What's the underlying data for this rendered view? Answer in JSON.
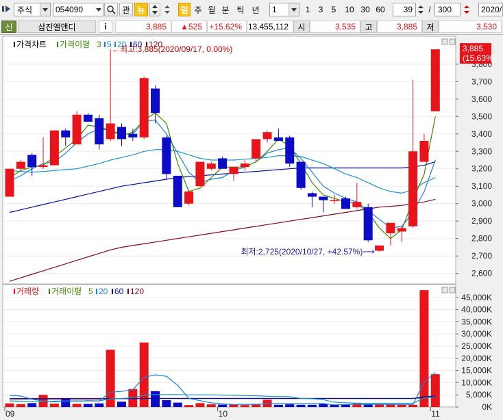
{
  "toolbar": {
    "market": "주식",
    "code": "054090",
    "fav_label": "관",
    "news_label": "뉴",
    "periods": [
      "일",
      "주",
      "월",
      "분",
      "틱",
      "년"
    ],
    "multiplier": "1",
    "quick_counts": [
      "1",
      "3",
      "5",
      "10",
      "30",
      "60"
    ],
    "bar_count": "39",
    "bar_total": "300",
    "date": "2020/"
  },
  "infobar": {
    "credit_label": "신",
    "name": "삼진엘앤디",
    "info_icon": "i",
    "price": "3,885",
    "change": "▲525",
    "change_pct": "+15.62%",
    "volume": "13,455,112",
    "open_label": "시",
    "open": "3,535",
    "high_label": "고",
    "high": "3,885",
    "low_label": "저",
    "low": "3,530"
  },
  "colors": {
    "up": "#e8141b",
    "down": "#0b0bc8",
    "ma3": "#3a8a00",
    "ma5": "#1e7fd6",
    "ma20": "#1c93c4",
    "ma60": "#000fa0",
    "ma120": "#7a0a22"
  },
  "chart_data": [
    {
      "type": "candlestick",
      "title": "가격차트",
      "legend": [
        "가격이평",
        "3",
        "5",
        "20",
        "60",
        "120"
      ],
      "ylim": [
        2540,
        3960
      ],
      "yticks": [
        2600,
        2700,
        2800,
        2900,
        3000,
        3100,
        3200,
        3300,
        3400,
        3500,
        3600,
        3700,
        3800,
        3885
      ],
      "ytick_labels": [
        "2,600",
        "2,700",
        "2,800",
        "2,900",
        "3,000",
        "3,100",
        "3,200",
        "3,300",
        "3,400",
        "3,500",
        "3,600",
        "3,700",
        "3,800",
        "3,885"
      ],
      "last_price_label": "3,885",
      "last_pct_label": "(15.63%)",
      "high_annotation": "←최고:3,885(2020/09/17, 0.00%)",
      "low_annotation": "최저:2,725(2020/10/27, +42.57%)⟶",
      "x_labels": [
        "09",
        "10",
        "11"
      ],
      "x_label_index": [
        0,
        19,
        38
      ],
      "candles": [
        {
          "o": 3040,
          "h": 3200,
          "l": 3040,
          "c": 3200
        },
        {
          "o": 3200,
          "h": 3250,
          "l": 3190,
          "c": 3240
        },
        {
          "o": 3280,
          "h": 3290,
          "l": 3160,
          "c": 3210
        },
        {
          "o": 3210,
          "h": 3380,
          "l": 3200,
          "c": 3220
        },
        {
          "o": 3220,
          "h": 3420,
          "l": 3220,
          "c": 3420
        },
        {
          "o": 3420,
          "h": 3430,
          "l": 3330,
          "c": 3380
        },
        {
          "o": 3340,
          "h": 3530,
          "l": 3340,
          "c": 3510
        },
        {
          "o": 3510,
          "h": 3520,
          "l": 3470,
          "c": 3470
        },
        {
          "o": 3490,
          "h": 3510,
          "l": 3310,
          "c": 3340
        },
        {
          "o": 3370,
          "h": 3885,
          "l": 3360,
          "c": 3460
        },
        {
          "o": 3440,
          "h": 3460,
          "l": 3330,
          "c": 3370
        },
        {
          "o": 3400,
          "h": 3430,
          "l": 3360,
          "c": 3380
        },
        {
          "o": 3380,
          "h": 3730,
          "l": 3370,
          "c": 3720
        },
        {
          "o": 3660,
          "h": 3680,
          "l": 3460,
          "c": 3520
        },
        {
          "o": 3380,
          "h": 3390,
          "l": 3140,
          "c": 3170
        },
        {
          "o": 3160,
          "h": 3160,
          "l": 2980,
          "c": 2980
        },
        {
          "o": 3000,
          "h": 3080,
          "l": 2990,
          "c": 3070
        },
        {
          "o": 3100,
          "h": 3240,
          "l": 3100,
          "c": 3240
        },
        {
          "o": 3200,
          "h": 3240,
          "l": 3190,
          "c": 3230
        },
        {
          "o": 3260,
          "h": 3270,
          "l": 3200,
          "c": 3200
        },
        {
          "o": 3170,
          "h": 3210,
          "l": 3130,
          "c": 3210
        },
        {
          "o": 3210,
          "h": 3250,
          "l": 3190,
          "c": 3230
        },
        {
          "o": 3260,
          "h": 3350,
          "l": 3240,
          "c": 3370
        },
        {
          "o": 3370,
          "h": 3420,
          "l": 3350,
          "c": 3410
        },
        {
          "o": 3380,
          "h": 3430,
          "l": 3360,
          "c": 3360
        },
        {
          "o": 3380,
          "h": 3390,
          "l": 3210,
          "c": 3230
        },
        {
          "o": 3240,
          "h": 3240,
          "l": 3080,
          "c": 3090
        },
        {
          "o": 3060,
          "h": 3070,
          "l": 2980,
          "c": 3040
        },
        {
          "o": 3040,
          "h": 3040,
          "l": 2950,
          "c": 3020
        },
        {
          "o": 3020,
          "h": 3050,
          "l": 3000,
          "c": 3020
        },
        {
          "o": 3030,
          "h": 3040,
          "l": 2970,
          "c": 2970
        },
        {
          "o": 2980,
          "h": 3120,
          "l": 2970,
          "c": 3010
        },
        {
          "o": 2980,
          "h": 3000,
          "l": 2780,
          "c": 2790
        },
        {
          "o": 2730,
          "h": 2760,
          "l": 2725,
          "c": 2760
        },
        {
          "o": 2830,
          "h": 2890,
          "l": 2760,
          "c": 2890
        },
        {
          "o": 2840,
          "h": 2870,
          "l": 2780,
          "c": 2860
        },
        {
          "o": 2870,
          "h": 3710,
          "l": 2860,
          "c": 3300
        },
        {
          "o": 3240,
          "h": 3400,
          "l": 3240,
          "c": 3360
        },
        {
          "o": 3530,
          "h": 3885,
          "l": 3530,
          "c": 3885
        }
      ],
      "ma3": [
        3150,
        3190,
        3210,
        3220,
        3270,
        3320,
        3370,
        3450,
        3440,
        3420,
        3390,
        3410,
        3480,
        3520,
        3460,
        3230,
        3070,
        3090,
        3150,
        3210,
        3210,
        3210,
        3240,
        3300,
        3370,
        3330,
        3230,
        3120,
        3050,
        3030,
        3010,
        3000,
        2950,
        2860,
        2800,
        2850,
        3020,
        3170,
        3500
      ],
      "ma5": [
        3130,
        3160,
        3200,
        3230,
        3240,
        3290,
        3350,
        3400,
        3430,
        3420,
        3400,
        3400,
        3470,
        3480,
        3400,
        3290,
        3180,
        3120,
        3140,
        3150,
        3190,
        3210,
        3240,
        3290,
        3310,
        3320,
        3260,
        3180,
        3100,
        3060,
        3030,
        3010,
        2960,
        2910,
        2860,
        2870,
        2950,
        3070,
        3250
      ],
      "ma20": [
        3190,
        3185,
        3180,
        3185,
        3190,
        3195,
        3200,
        3215,
        3230,
        3250,
        3265,
        3280,
        3300,
        3310,
        3310,
        3300,
        3280,
        3260,
        3250,
        3250,
        3250,
        3255,
        3260,
        3265,
        3275,
        3275,
        3270,
        3250,
        3230,
        3200,
        3170,
        3150,
        3120,
        3090,
        3070,
        3060,
        3080,
        3120,
        3150
      ],
      "ma60": [
        2950,
        2965,
        2980,
        2995,
        3010,
        3025,
        3040,
        3055,
        3070,
        3085,
        3100,
        3110,
        3120,
        3130,
        3140,
        3150,
        3155,
        3160,
        3165,
        3170,
        3175,
        3180,
        3185,
        3190,
        3195,
        3200,
        3205,
        3205,
        3205,
        3205,
        3205,
        3205,
        3205,
        3205,
        3205,
        3205,
        3210,
        3220,
        3240
      ],
      "ma120": [
        2555,
        2575,
        2595,
        2615,
        2635,
        2655,
        2675,
        2695,
        2715,
        2735,
        2750,
        2760,
        2770,
        2780,
        2790,
        2800,
        2810,
        2820,
        2830,
        2840,
        2850,
        2860,
        2870,
        2880,
        2890,
        2900,
        2910,
        2920,
        2930,
        2940,
        2950,
        2960,
        2970,
        2980,
        2985,
        2990,
        3000,
        3010,
        3025
      ]
    },
    {
      "type": "bar",
      "title": "거래량",
      "legend": [
        "거래이평",
        "5",
        "20",
        "60",
        "120"
      ],
      "ylim": [
        0,
        50000
      ],
      "yticks": [
        0,
        5000,
        10000,
        15000,
        20000,
        25000,
        30000,
        35000,
        40000,
        45000
      ],
      "ytick_labels": [
        "0K",
        "5,000K",
        "10,000K",
        "15,000K",
        "20,000K",
        "25,000K",
        "30,000K",
        "35,000K",
        "40,000K",
        "45,000K"
      ],
      "values": [
        1500,
        1200,
        1600,
        5000,
        1400,
        3500,
        1300,
        1300,
        1500,
        23500,
        2200,
        7400,
        26500,
        6500,
        2800,
        1800,
        800,
        1600,
        1100,
        1000,
        1000,
        800,
        1300,
        3000,
        900,
        1100,
        900,
        900,
        1300,
        900,
        900,
        1500,
        1100,
        1200,
        1000,
        900,
        900,
        48000,
        13455
      ],
      "up": [
        true,
        true,
        false,
        true,
        true,
        false,
        true,
        false,
        false,
        true,
        false,
        true,
        true,
        false,
        false,
        false,
        true,
        true,
        true,
        false,
        true,
        true,
        true,
        true,
        false,
        false,
        false,
        false,
        false,
        false,
        false,
        true,
        false,
        true,
        true,
        true,
        true,
        true,
        true
      ],
      "ma5": [
        4800,
        4500,
        3200,
        2500,
        2100,
        2500,
        2400,
        2600,
        2500,
        6100,
        6400,
        7100,
        12200,
        13200,
        12600,
        8900,
        3500,
        2600,
        1700,
        1300,
        1000,
        1100,
        1000,
        1400,
        1400,
        1400,
        1400,
        1400,
        1400,
        900,
        1000,
        1100,
        1100,
        1100,
        1100,
        1100,
        1000,
        10200,
        14200
      ],
      "ma20": [
        2500,
        2400,
        2300,
        2300,
        2400,
        2500,
        2500,
        2500,
        2500,
        3400,
        3500,
        3800,
        4900,
        5100,
        5100,
        5100,
        5000,
        5000,
        5000,
        4900,
        4800,
        4700,
        4600,
        4400,
        4300,
        4200,
        3500,
        3400,
        3000,
        2000,
        1700,
        1600,
        1500,
        1500,
        1500,
        1500,
        1500,
        3700,
        4200
      ],
      "ma60": [
        3300,
        3300,
        3300,
        3300,
        3300,
        3300,
        3300,
        3300,
        3300,
        3400,
        3400,
        3400,
        3500,
        3500,
        3500,
        3500,
        3500,
        3500,
        3500,
        3500,
        3500,
        3500,
        3500,
        3500,
        3500,
        3500,
        3500,
        3500,
        3500,
        3500,
        3500,
        3500,
        3500,
        3500,
        3500,
        3500,
        3500,
        4200,
        4500
      ],
      "ma120": [
        3500,
        3500,
        3500,
        3500,
        3500,
        3500,
        3500,
        3500,
        3500,
        3500,
        3500,
        3500,
        3500,
        3500,
        3500,
        3500,
        3500,
        3500,
        3500,
        3500,
        3500,
        3500,
        3500,
        3500,
        3500,
        3500,
        3500,
        3500,
        3500,
        3500,
        3500,
        3500,
        3500,
        3500,
        3500,
        3500,
        3500,
        3800,
        4000
      ]
    }
  ]
}
